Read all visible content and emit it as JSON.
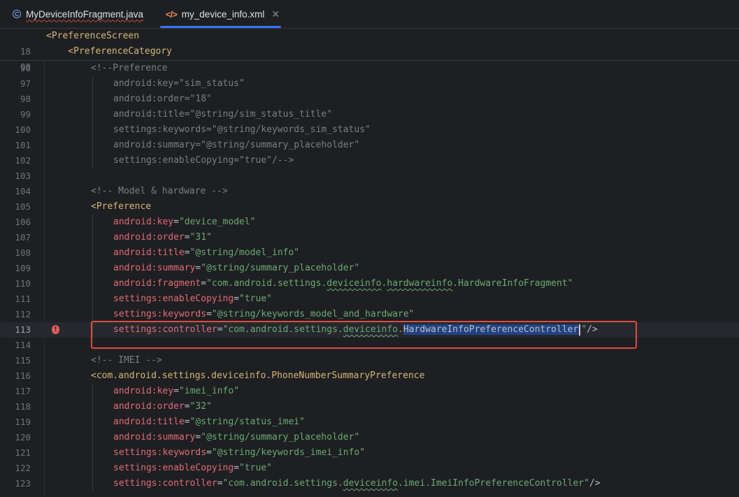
{
  "tabs": [
    {
      "label": "MyDeviceInfoFragment.java",
      "icon": "java-class-icon",
      "active": false
    },
    {
      "label": "my_device_info.xml",
      "icon": "xml-file-icon",
      "active": true
    }
  ],
  "sticky_lines": [
    {
      "num": "18",
      "text": "<PreferenceScreen"
    },
    {
      "num": "90",
      "text": "    <PreferenceCategory"
    }
  ],
  "lines": [
    {
      "num": "96",
      "indent": 2,
      "parts": [
        {
          "t": "<!--Preference",
          "c": "cm"
        }
      ]
    },
    {
      "num": "97",
      "indent": 3,
      "parts": [
        {
          "t": "android:key=\"sim_status\"",
          "c": "cm"
        }
      ]
    },
    {
      "num": "98",
      "indent": 3,
      "parts": [
        {
          "t": "android:order=\"18\"",
          "c": "cm"
        }
      ]
    },
    {
      "num": "99",
      "indent": 3,
      "parts": [
        {
          "t": "android:title=\"@string/sim_status_title\"",
          "c": "cm"
        }
      ]
    },
    {
      "num": "100",
      "indent": 3,
      "parts": [
        {
          "t": "settings:keywords=\"@string/keywords_sim_status\"",
          "c": "cm"
        }
      ]
    },
    {
      "num": "101",
      "indent": 3,
      "parts": [
        {
          "t": "android:summary=\"@string/summary_placeholder\"",
          "c": "cm"
        }
      ]
    },
    {
      "num": "102",
      "indent": 3,
      "parts": [
        {
          "t": "settings:enableCopying=\"true\"/-->",
          "c": "cm"
        }
      ]
    },
    {
      "num": "103",
      "indent": 0,
      "parts": []
    },
    {
      "num": "104",
      "indent": 2,
      "parts": [
        {
          "t": "<!-- Model & hardware -->",
          "c": "cm"
        }
      ]
    },
    {
      "num": "105",
      "indent": 2,
      "parts": [
        {
          "t": "<Preference",
          "c": "tag"
        }
      ]
    },
    {
      "num": "106",
      "indent": 3,
      "parts": [
        {
          "t": "android:",
          "c": "attr"
        },
        {
          "t": "key",
          "c": "attr"
        },
        {
          "t": "=",
          "c": "pun"
        },
        {
          "t": "\"device_model\"",
          "c": "str"
        }
      ]
    },
    {
      "num": "107",
      "indent": 3,
      "parts": [
        {
          "t": "android:",
          "c": "attr"
        },
        {
          "t": "order",
          "c": "attr"
        },
        {
          "t": "=",
          "c": "pun"
        },
        {
          "t": "\"31\"",
          "c": "str"
        }
      ]
    },
    {
      "num": "108",
      "indent": 3,
      "parts": [
        {
          "t": "android:",
          "c": "attr"
        },
        {
          "t": "title",
          "c": "attr"
        },
        {
          "t": "=",
          "c": "pun"
        },
        {
          "t": "\"@string/model_info\"",
          "c": "str"
        }
      ]
    },
    {
      "num": "109",
      "indent": 3,
      "parts": [
        {
          "t": "android:",
          "c": "attr"
        },
        {
          "t": "summary",
          "c": "attr"
        },
        {
          "t": "=",
          "c": "pun"
        },
        {
          "t": "\"@string/summary_placeholder\"",
          "c": "str"
        }
      ]
    },
    {
      "num": "110",
      "indent": 3,
      "parts": [
        {
          "t": "android:",
          "c": "attr"
        },
        {
          "t": "fragment",
          "c": "attr"
        },
        {
          "t": "=",
          "c": "pun"
        },
        {
          "t": "\"com.android.settings.",
          "c": "str"
        },
        {
          "t": "deviceinfo",
          "c": "squig"
        },
        {
          "t": ".",
          "c": "str"
        },
        {
          "t": "hardwareinfo",
          "c": "squig"
        },
        {
          "t": ".HardwareInfoFragment\"",
          "c": "str"
        }
      ]
    },
    {
      "num": "111",
      "indent": 3,
      "parts": [
        {
          "t": "settings:",
          "c": "attr"
        },
        {
          "t": "enableCopying",
          "c": "attr"
        },
        {
          "t": "=",
          "c": "pun"
        },
        {
          "t": "\"true\"",
          "c": "str"
        }
      ]
    },
    {
      "num": "112",
      "indent": 3,
      "parts": [
        {
          "t": "settings:",
          "c": "attr"
        },
        {
          "t": "keywords",
          "c": "attr"
        },
        {
          "t": "=",
          "c": "pun"
        },
        {
          "t": "\"@string/keywords_model_and_hardware\"",
          "c": "str"
        }
      ]
    },
    {
      "num": "113",
      "indent": 3,
      "current": true,
      "parts": [
        {
          "t": "settings:",
          "c": "attr"
        },
        {
          "t": "controller",
          "c": "attr"
        },
        {
          "t": "=",
          "c": "pun"
        },
        {
          "t": "\"com.android.settings.",
          "c": "str"
        },
        {
          "t": "deviceinfo",
          "c": "squig"
        },
        {
          "t": ".",
          "c": "str"
        },
        {
          "t": "HardwareInfoPreferenceController",
          "c": "sel"
        },
        {
          "t": "",
          "c": "caret"
        },
        {
          "t": "\"",
          "c": "str"
        },
        {
          "t": "/>",
          "c": "pun"
        }
      ]
    },
    {
      "num": "114",
      "indent": 0,
      "parts": []
    },
    {
      "num": "115",
      "indent": 2,
      "parts": [
        {
          "t": "<!-- IMEI -->",
          "c": "cm"
        }
      ]
    },
    {
      "num": "116",
      "indent": 2,
      "parts": [
        {
          "t": "<com.android.settings.deviceinfo.PhoneNumberSummaryPreference",
          "c": "tag"
        }
      ]
    },
    {
      "num": "117",
      "indent": 3,
      "parts": [
        {
          "t": "android:",
          "c": "attr"
        },
        {
          "t": "key",
          "c": "attr"
        },
        {
          "t": "=",
          "c": "pun"
        },
        {
          "t": "\"imei_info\"",
          "c": "str"
        }
      ]
    },
    {
      "num": "118",
      "indent": 3,
      "parts": [
        {
          "t": "android:",
          "c": "attr"
        },
        {
          "t": "order",
          "c": "attr"
        },
        {
          "t": "=",
          "c": "pun"
        },
        {
          "t": "\"32\"",
          "c": "str"
        }
      ]
    },
    {
      "num": "119",
      "indent": 3,
      "parts": [
        {
          "t": "android:",
          "c": "attr"
        },
        {
          "t": "title",
          "c": "attr"
        },
        {
          "t": "=",
          "c": "pun"
        },
        {
          "t": "\"@string/status_imei\"",
          "c": "str"
        }
      ]
    },
    {
      "num": "120",
      "indent": 3,
      "parts": [
        {
          "t": "android:",
          "c": "attr"
        },
        {
          "t": "summary",
          "c": "attr"
        },
        {
          "t": "=",
          "c": "pun"
        },
        {
          "t": "\"@string/summary_placeholder\"",
          "c": "str"
        }
      ]
    },
    {
      "num": "121",
      "indent": 3,
      "parts": [
        {
          "t": "settings:",
          "c": "attr"
        },
        {
          "t": "keywords",
          "c": "attr"
        },
        {
          "t": "=",
          "c": "pun"
        },
        {
          "t": "\"@string/keywords_imei_info\"",
          "c": "str"
        }
      ]
    },
    {
      "num": "122",
      "indent": 3,
      "parts": [
        {
          "t": "settings:",
          "c": "attr"
        },
        {
          "t": "enableCopying",
          "c": "attr"
        },
        {
          "t": "=",
          "c": "pun"
        },
        {
          "t": "\"true\"",
          "c": "str"
        }
      ]
    },
    {
      "num": "123",
      "indent": 3,
      "parts": [
        {
          "t": "settings:",
          "c": "attr"
        },
        {
          "t": "controller",
          "c": "attr"
        },
        {
          "t": "=",
          "c": "pun"
        },
        {
          "t": "\"com.android.settings.",
          "c": "str"
        },
        {
          "t": "deviceinfo",
          "c": "squig"
        },
        {
          "t": ".imei.ImeiInfoPreferenceController\"",
          "c": "str"
        },
        {
          "t": "/>",
          "c": "pun"
        }
      ]
    }
  ],
  "colors": {
    "background": "#1e1f22",
    "tag": "#d5b778",
    "attribute": "#e06c75",
    "string": "#6aab73",
    "comment": "#7a7e85",
    "selection": "#214283",
    "highlight_box": "#e04b3c",
    "active_tab_underline": "#3574f0"
  }
}
